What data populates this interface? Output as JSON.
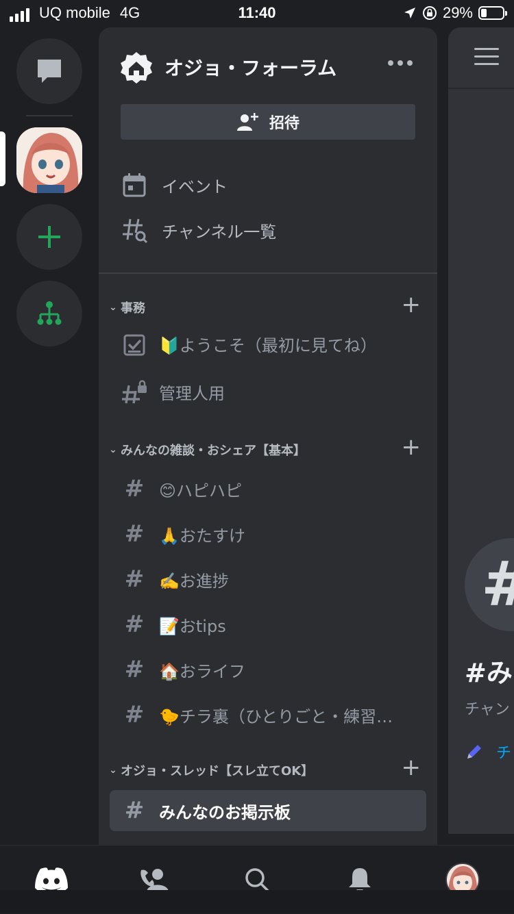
{
  "status_bar": {
    "carrier": "UQ mobile",
    "network": "4G",
    "time": "11:40",
    "battery": "29%"
  },
  "server": {
    "name": "オジョ・フォーラム",
    "invite_label": "招待"
  },
  "utility": [
    {
      "label": "イベント",
      "icon": "calendar-icon"
    },
    {
      "label": "チャンネル一覧",
      "icon": "channel-browse-icon"
    }
  ],
  "categories": [
    {
      "name": "事務",
      "channels": [
        {
          "name": "🔰ようこそ（最初に見てね）",
          "icon": "rules-check-icon"
        },
        {
          "name": "管理人用",
          "icon": "locked-hash-icon"
        }
      ]
    },
    {
      "name": "みんなの雑談・おシェア【基本】",
      "channels": [
        {
          "name": "😊ハピハピ",
          "icon": "hash-icon"
        },
        {
          "name": "🙏おたすけ",
          "icon": "hash-icon"
        },
        {
          "name": "✍️お進捗",
          "icon": "hash-icon"
        },
        {
          "name": "📝おtips",
          "icon": "hash-icon"
        },
        {
          "name": "🏠おライフ",
          "icon": "hash-icon"
        },
        {
          "name": "🐤チラ裏（ひとりごと・練習…",
          "icon": "hash-icon"
        }
      ]
    },
    {
      "name": "オジョ・スレッド【スレ立てOK】",
      "channels": [
        {
          "name": "みんなのお掲示板",
          "icon": "hash-icon",
          "active": true
        }
      ]
    }
  ],
  "chat_preview": {
    "title": "#み",
    "subtitle": "チャン",
    "link": "チ"
  },
  "tabs": [
    "discord-home-icon",
    "friends-icon",
    "search-icon",
    "bell-icon",
    "profile-avatar"
  ],
  "colors": {
    "bg": "#1e1f22",
    "panel": "#2b2d31",
    "chat": "#313338",
    "green": "#23a55a",
    "link": "#00a8fc"
  }
}
